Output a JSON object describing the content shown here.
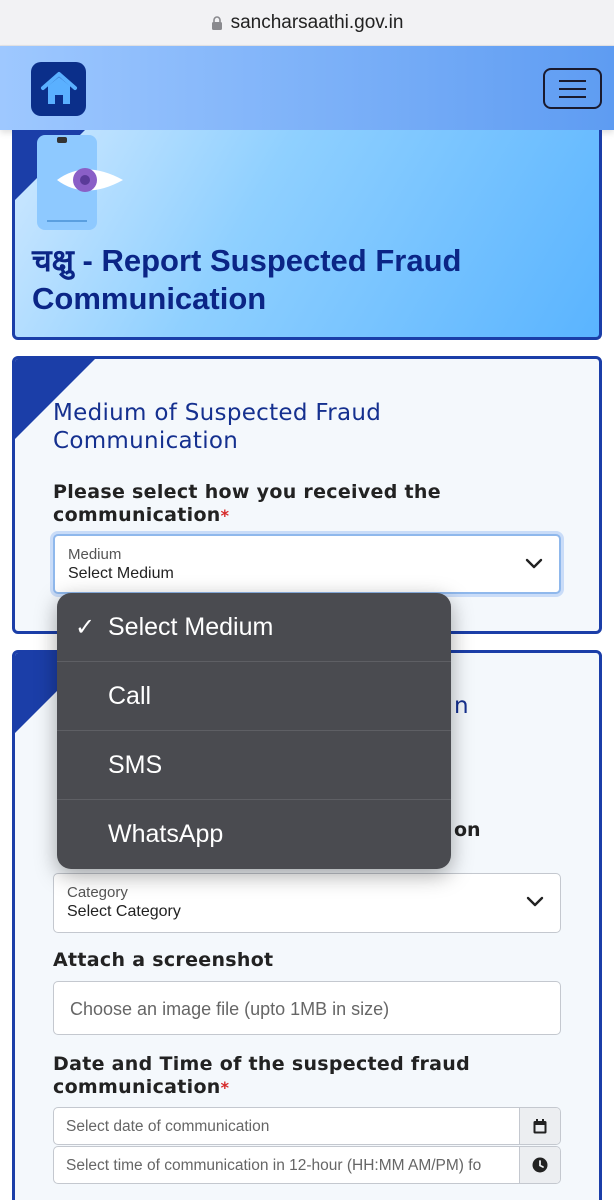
{
  "browser": {
    "url": "sancharsaathi.gov.in"
  },
  "banner": {
    "title": "चक्षु - Report Suspected Fraud Communication"
  },
  "medium_card": {
    "title": "Medium of Suspected Fraud Communication",
    "question": "Please select how you received the communication",
    "required_mark": "*",
    "select": {
      "small_label": "Medium",
      "value": "Select Medium"
    }
  },
  "dropdown": {
    "selected_mark": "✓",
    "options": [
      "Select Medium",
      "Call",
      "SMS",
      "WhatsApp"
    ]
  },
  "category_card": {
    "title_fragment": "n",
    "label_fragment": "on",
    "select": {
      "small_label": "Category",
      "value": "Select Category"
    },
    "attach_label": "Attach a screenshot",
    "attach_placeholder": "Choose an image file (upto 1MB in size)",
    "datetime_label": "Date and Time of the suspected fraud communication",
    "required_mark": "*",
    "date_placeholder": "Select date of communication",
    "time_placeholder": "Select time of communication in 12-hour (HH:MM AM/PM) fo"
  },
  "icons": {
    "lock": "lock-icon",
    "home": "home-icon",
    "menu": "hamburger-menu-icon",
    "chevron": "chevron-down-icon",
    "calendar": "calendar-icon",
    "clock": "clock-icon",
    "illustration": "eye-phone-icon"
  },
  "colors": {
    "primary": "#1b3ea8",
    "title": "#0b2586",
    "required": "#d62828",
    "dropdown_bg": "#4a4b50"
  }
}
